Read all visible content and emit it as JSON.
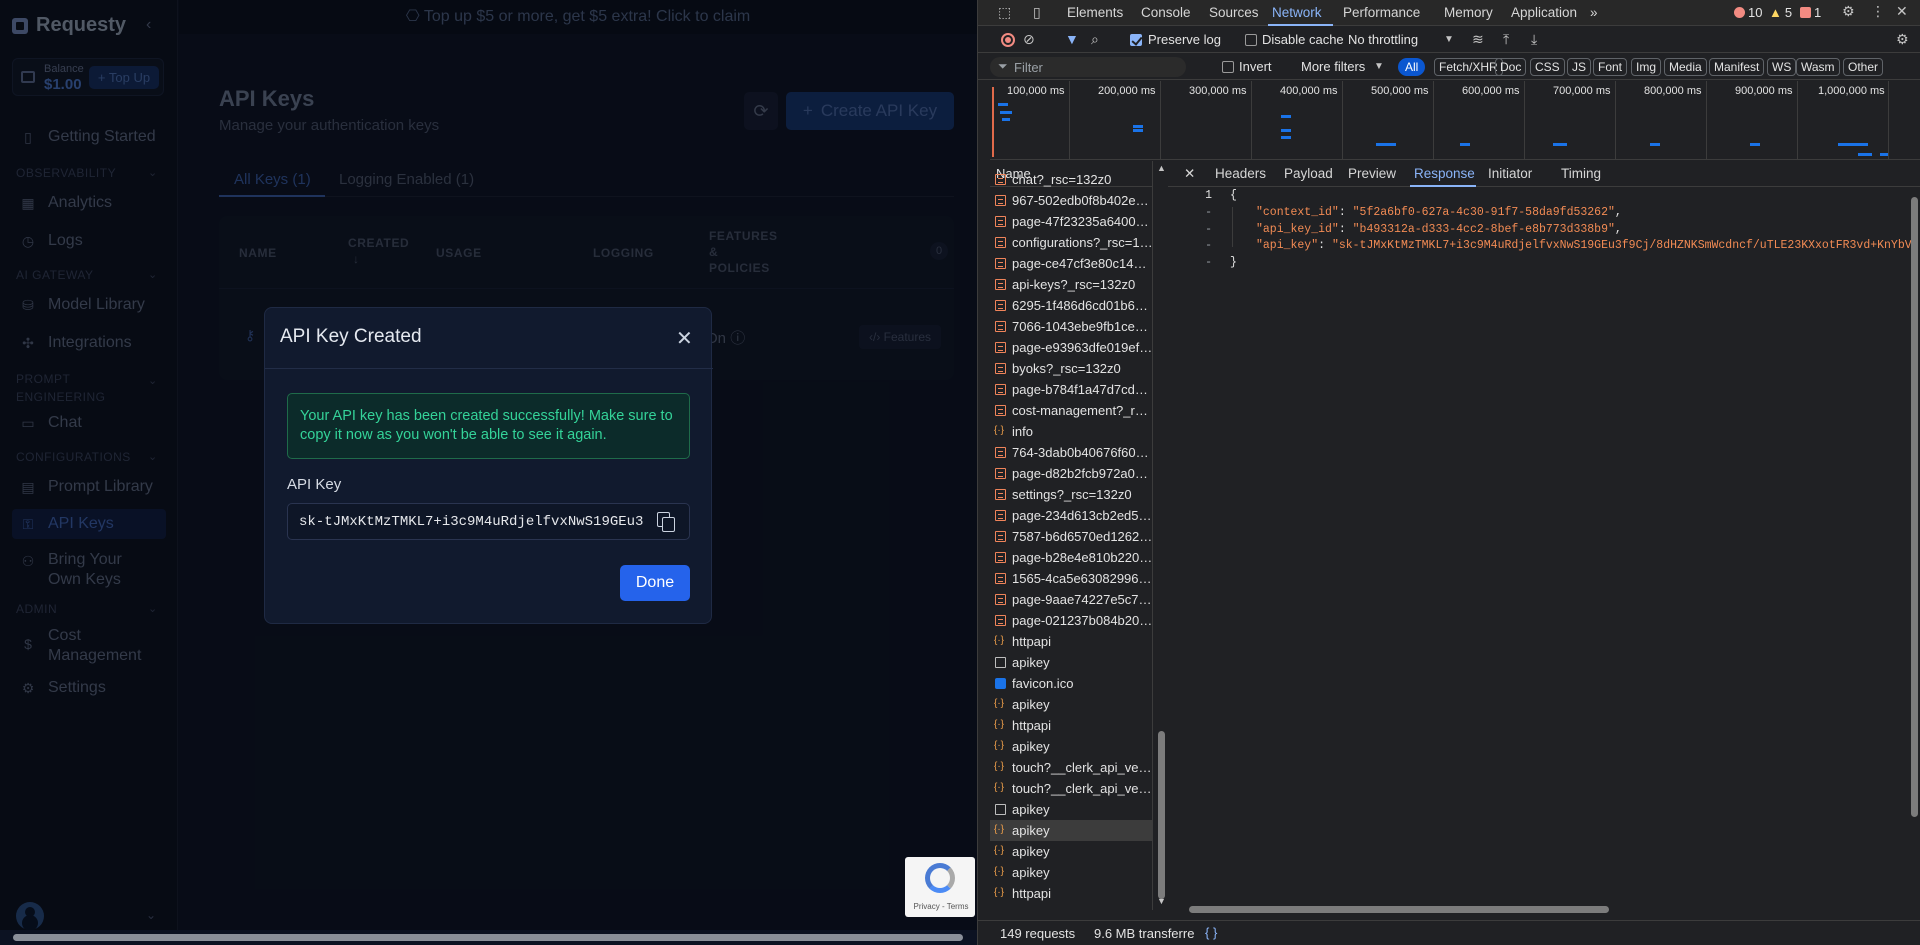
{
  "app": {
    "brand": "Requesty",
    "balance": {
      "label": "Balance",
      "amount": "$1.00",
      "topup": "+ Top Up"
    },
    "sidebar": {
      "items": [
        {
          "label": "Getting Started",
          "icon": "book-icon"
        },
        {
          "label": "Analytics",
          "icon": "chart-icon"
        },
        {
          "label": "Logs",
          "icon": "clock-icon"
        },
        {
          "label": "Model Library",
          "icon": "database-icon"
        },
        {
          "label": "Integrations",
          "icon": "puzzle-icon"
        },
        {
          "label": "Chat",
          "icon": "message-icon"
        },
        {
          "label": "Prompt Library",
          "icon": "library-icon"
        },
        {
          "label": "API Keys",
          "icon": "key-icon"
        },
        {
          "label": "Bring Your Own Keys",
          "icon": "user-key-icon"
        },
        {
          "label": "Cost Management",
          "icon": "dollar-icon"
        },
        {
          "label": "Settings",
          "icon": "gear-icon"
        }
      ],
      "sections": [
        "OBSERVABILITY",
        "AI GATEWAY",
        "PROMPT ENGINEERING",
        "CONFIGURATIONS",
        "ADMIN"
      ]
    },
    "banner": "Top up $5 or more, get $5 extra! Click to claim",
    "page": {
      "title": "API Keys",
      "subtitle": "Manage your authentication keys",
      "create_button": "Create API Key",
      "tabs": [
        "All Keys (1)",
        "Logging Enabled (1)"
      ],
      "table": {
        "headers": [
          "NAME",
          "CREATED",
          "USAGE",
          "LOGGING",
          "FEATURES & POLICIES"
        ],
        "features_count": "0",
        "row": {
          "logging": "On",
          "features_button": "Features"
        }
      }
    },
    "modal": {
      "title": "API Key Created",
      "success_message": "Your API key has been created successfully! Make sure to copy it now as you won't be able to see it again.",
      "key_label": "API Key",
      "key_value": "sk-tJMxKtMzTMKL7+i3c9M4uRdjelfvxNwS19GEu3f9Cj/8dHZNKSmWcdncf/uTLE23KXxotFR3vd+KnYbV",
      "done_button": "Done"
    },
    "recaptcha": {
      "text": "Privacy - Terms"
    }
  },
  "devtools": {
    "tabs": [
      "Elements",
      "Console",
      "Sources",
      "Network",
      "Performance",
      "Memory",
      "Application"
    ],
    "more_tabs": "»",
    "errors": "10",
    "warnings": "5",
    "issues": "1",
    "toolbar": {
      "preserve_log": "Preserve log",
      "disable_cache": "Disable cache",
      "throttling": "No throttling"
    },
    "filter": {
      "placeholder": "Filter",
      "invert": "Invert",
      "more_filters": "More filters",
      "chips": [
        "All",
        "Fetch/XHR",
        "Doc",
        "CSS",
        "JS",
        "Font",
        "Img",
        "Media",
        "Manifest",
        "WS",
        "Wasm",
        "Other"
      ]
    },
    "timeline_labels": [
      "100,000 ms",
      "200,000 ms",
      "300,000 ms",
      "400,000 ms",
      "500,000 ms",
      "600,000 ms",
      "700,000 ms",
      "800,000 ms",
      "900,000 ms",
      "1,000,000 ms"
    ],
    "name_header": "Name",
    "requests": [
      {
        "name": "chat?_rsc=132z0",
        "type": "doc"
      },
      {
        "name": "967-502edb0f8b402edc.j...",
        "type": "doc"
      },
      {
        "name": "page-47f23235a6400a78....",
        "type": "doc"
      },
      {
        "name": "configurations?_rsc=132z0",
        "type": "doc"
      },
      {
        "name": "page-ce47cf3e80c14771.j...",
        "type": "doc"
      },
      {
        "name": "api-keys?_rsc=132z0",
        "type": "doc"
      },
      {
        "name": "6295-1f486d6cd01b6da6....",
        "type": "doc"
      },
      {
        "name": "7066-1043ebe9fb1ce0b3....",
        "type": "doc"
      },
      {
        "name": "page-e93963dfe019ef84.j...",
        "type": "doc"
      },
      {
        "name": "byoks?_rsc=132z0",
        "type": "doc"
      },
      {
        "name": "page-b784f1a47d7cd968....",
        "type": "doc"
      },
      {
        "name": "cost-management?_rsc=1...",
        "type": "doc"
      },
      {
        "name": "info",
        "type": "json"
      },
      {
        "name": "764-3dab0b40676f60d1.j...",
        "type": "doc"
      },
      {
        "name": "page-d82b2fcb972a09a9....",
        "type": "doc"
      },
      {
        "name": "settings?_rsc=132z0",
        "type": "doc"
      },
      {
        "name": "page-234d613cb2ed5c90....",
        "type": "doc"
      },
      {
        "name": "7587-b6d6570ed1262656....",
        "type": "doc"
      },
      {
        "name": "page-b28e4e810b220fab....",
        "type": "doc"
      },
      {
        "name": "1565-4ca5e63082996b71....",
        "type": "doc"
      },
      {
        "name": "page-9aae74227e5c7261....",
        "type": "doc"
      },
      {
        "name": "page-021237b084b2083c....",
        "type": "doc"
      },
      {
        "name": "httpapi",
        "type": "json"
      },
      {
        "name": "apikey",
        "type": "blank"
      },
      {
        "name": "favicon.ico",
        "type": "fav"
      },
      {
        "name": "apikey",
        "type": "json"
      },
      {
        "name": "httpapi",
        "type": "json"
      },
      {
        "name": "apikey",
        "type": "json"
      },
      {
        "name": "touch?__clerk_api_version...",
        "type": "json"
      },
      {
        "name": "touch?__clerk_api_version...",
        "type": "json"
      },
      {
        "name": "apikey",
        "type": "blank"
      },
      {
        "name": "apikey",
        "type": "json",
        "selected": true
      },
      {
        "name": "apikey",
        "type": "json"
      },
      {
        "name": "apikey",
        "type": "json"
      },
      {
        "name": "httpapi",
        "type": "json"
      }
    ],
    "detail_tabs": [
      "Headers",
      "Payload",
      "Preview",
      "Response",
      "Initiator",
      "Timing"
    ],
    "response": {
      "line_number": "1",
      "open": "{",
      "close": "}",
      "context_id_key": "\"context_id\"",
      "context_id_val": "\"5f2a6bf0-627a-4c30-91f7-58da9fd53262\"",
      "api_key_id_key": "\"api_key_id\"",
      "api_key_id_val": "\"b493312a-d333-4cc2-8bef-e8b773d338b9\"",
      "api_key_key": "\"api_key\"",
      "api_key_val": "\"sk-tJMxKtMzTMKL7+i3c9M4uRdjelfvxNwS19GEu3f9Cj/8dHZNKSmWcdncf/uTLE23KXxotFR3vd+KnYbV"
    },
    "status": {
      "requests": "149 requests",
      "transferred": "9.6 MB transferre"
    }
  }
}
